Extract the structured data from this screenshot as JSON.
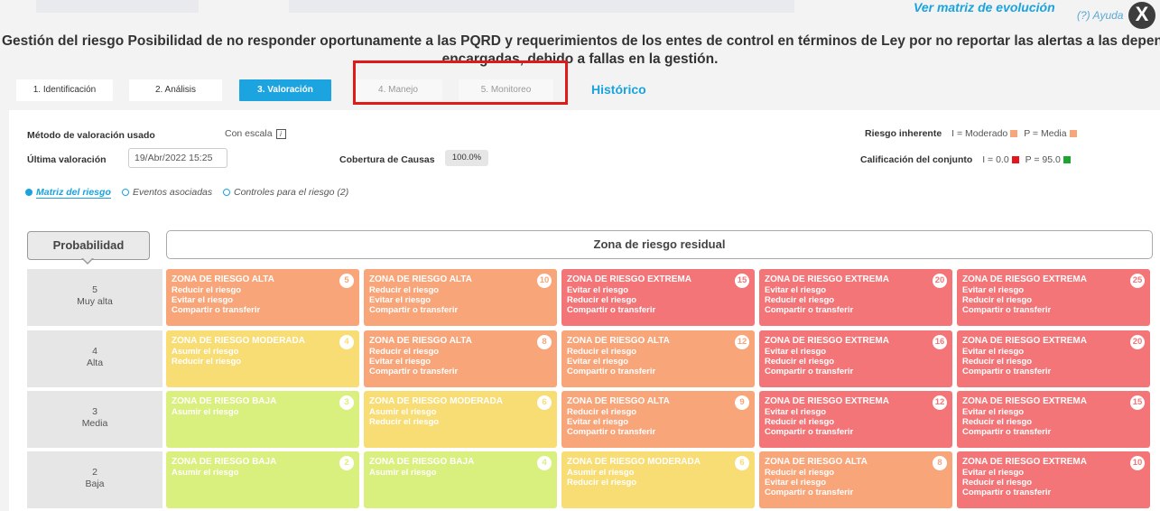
{
  "header": {
    "help": "(?) Ayuda",
    "close": "X",
    "evolution_link": "Ver matriz de evolución",
    "title_line1": "Gestión del riesgo Posibilidad de no responder oportunamente a las PQRD y requerimientos de los entes de control en términos de Ley por no reportar las alertas a las dependencias",
    "title_line2": "encargadas, debido a fallas en la gestión."
  },
  "tabs": [
    {
      "label": "1. Identificación",
      "state": "normal"
    },
    {
      "label": "2. Análisis",
      "state": "normal"
    },
    {
      "label": "3. Valoración",
      "state": "active"
    },
    {
      "label": "4. Manejo",
      "state": "disabled"
    },
    {
      "label": "5. Monitoreo",
      "state": "disabled"
    }
  ],
  "historico": "Histórico",
  "info": {
    "metodo_label": "Método de valoración usado",
    "metodo_value": "Con escala",
    "info_icon": "i",
    "ultima_label": "Última valoración",
    "ultima_value": "19/Abr/2022 15:25",
    "cobertura_label": "Cobertura de Causas",
    "cobertura_value": "100.0%",
    "inherente_label": "Riesgo inherente",
    "inherente_i": "I = Moderado",
    "inherente_p": "P = Media",
    "conjunto_label": "Calificación del conjunto",
    "conjunto_i": "I = 0.0",
    "conjunto_p": "P = 95.0"
  },
  "colors": {
    "accent": "#1ba4e0",
    "alta": "#f9a57a",
    "extrema": "#f47578",
    "moderada": "#f7dd74",
    "baja": "#d9ef7e",
    "red_square": "#e8141b",
    "green_square": "#1ea52f",
    "orange_square": "#f9a57a"
  },
  "options": [
    {
      "label": "Matriz del riesgo",
      "selected": true
    },
    {
      "label": "Eventos asociadas",
      "selected": false
    },
    {
      "label": "Controles para el riesgo (2)",
      "selected": false
    }
  ],
  "matrix": {
    "prob_header": "Probabilidad",
    "zone_header": "Zona de riesgo residual",
    "rows": [
      {
        "num": "5",
        "name": "Muy alta",
        "cells": [
          {
            "title": "ZONA DE RIESGO ALTA",
            "level": "alta",
            "score": "5",
            "actions": [
              "Reducir el riesgo",
              "Evitar el riesgo",
              "Compartir o transferir"
            ]
          },
          {
            "title": "ZONA DE RIESGO ALTA",
            "level": "alta",
            "score": "10",
            "actions": [
              "Reducir el riesgo",
              "Evitar el riesgo",
              "Compartir o transferir"
            ]
          },
          {
            "title": "ZONA DE RIESGO EXTREMA",
            "level": "extrema",
            "score": "15",
            "actions": [
              "Evitar el riesgo",
              "Reducir el riesgo",
              "Compartir o transferir"
            ]
          },
          {
            "title": "ZONA DE RIESGO EXTREMA",
            "level": "extrema",
            "score": "20",
            "actions": [
              "Evitar el riesgo",
              "Reducir el riesgo",
              "Compartir o transferir"
            ]
          },
          {
            "title": "ZONA DE RIESGO EXTREMA",
            "level": "extrema",
            "score": "25",
            "actions": [
              "Evitar el riesgo",
              "Reducir el riesgo",
              "Compartir o transferir"
            ]
          }
        ]
      },
      {
        "num": "4",
        "name": "Alta",
        "cells": [
          {
            "title": "ZONA DE RIESGO MODERADA",
            "level": "moderada",
            "score": "4",
            "actions": [
              "Asumir el riesgo",
              "Reducir el riesgo"
            ]
          },
          {
            "title": "ZONA DE RIESGO ALTA",
            "level": "alta",
            "score": "8",
            "actions": [
              "Reducir el riesgo",
              "Evitar el riesgo",
              "Compartir o transferir"
            ]
          },
          {
            "title": "ZONA DE RIESGO ALTA",
            "level": "alta",
            "score": "12",
            "actions": [
              "Reducir el riesgo",
              "Evitar el riesgo",
              "Compartir o transferir"
            ]
          },
          {
            "title": "ZONA DE RIESGO EXTREMA",
            "level": "extrema",
            "score": "16",
            "actions": [
              "Evitar el riesgo",
              "Reducir el riesgo",
              "Compartir o transferir"
            ]
          },
          {
            "title": "ZONA DE RIESGO EXTREMA",
            "level": "extrema",
            "score": "20",
            "actions": [
              "Evitar el riesgo",
              "Reducir el riesgo",
              "Compartir o transferir"
            ]
          }
        ]
      },
      {
        "num": "3",
        "name": "Media",
        "cells": [
          {
            "title": "ZONA DE RIESGO BAJA",
            "level": "baja",
            "score": "3",
            "actions": [
              "Asumir el riesgo"
            ]
          },
          {
            "title": "ZONA DE RIESGO MODERADA",
            "level": "moderada",
            "score": "6",
            "actions": [
              "Asumir el riesgo",
              "Reducir el riesgo"
            ]
          },
          {
            "title": "ZONA DE RIESGO ALTA",
            "level": "alta",
            "score": "9",
            "actions": [
              "Reducir el riesgo",
              "Evitar el riesgo",
              "Compartir o transferir"
            ]
          },
          {
            "title": "ZONA DE RIESGO EXTREMA",
            "level": "extrema",
            "score": "12",
            "actions": [
              "Evitar el riesgo",
              "Reducir el riesgo",
              "Compartir o transferir"
            ]
          },
          {
            "title": "ZONA DE RIESGO EXTREMA",
            "level": "extrema",
            "score": "15",
            "actions": [
              "Evitar el riesgo",
              "Reducir el riesgo",
              "Compartir o transferir"
            ]
          }
        ]
      },
      {
        "num": "2",
        "name": "Baja",
        "cells": [
          {
            "title": "ZONA DE RIESGO BAJA",
            "level": "baja",
            "score": "2",
            "actions": [
              "Asumir el riesgo"
            ]
          },
          {
            "title": "ZONA DE RIESGO BAJA",
            "level": "baja",
            "score": "4",
            "actions": [
              "Asumir el riesgo"
            ]
          },
          {
            "title": "ZONA DE RIESGO MODERADA",
            "level": "moderada",
            "score": "6",
            "actions": [
              "Asumir el riesgo",
              "Reducir el riesgo"
            ]
          },
          {
            "title": "ZONA DE RIESGO ALTA",
            "level": "alta",
            "score": "8",
            "actions": [
              "Reducir el riesgo",
              "Evitar el riesgo",
              "Compartir o transferir"
            ]
          },
          {
            "title": "ZONA DE RIESGO EXTREMA",
            "level": "extrema",
            "score": "10",
            "actions": [
              "Evitar el riesgo",
              "Reducir el riesgo",
              "Compartir o transferir"
            ]
          }
        ]
      }
    ]
  }
}
